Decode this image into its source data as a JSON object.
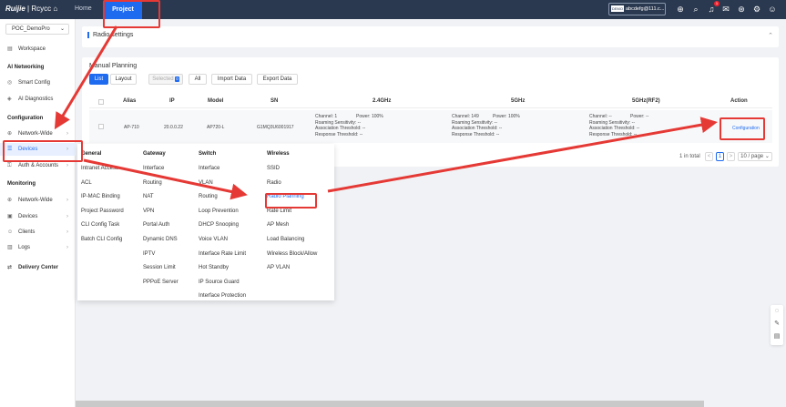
{
  "topbar": {
    "logo_brand": "Ruijie",
    "logo_sub": "| Rcycc",
    "nav_home": "Home",
    "nav_project": "Project",
    "user_tag": "DEMO",
    "user_email": "abcdefg@111.c..."
  },
  "sidebar": {
    "project_select": "POC_DemoPro",
    "workspace": "Workspace",
    "ai_networking_head": "AI Networking",
    "smart_config": "Smart Config",
    "ai_diagnostics": "AI Diagnostics",
    "configuration_head": "Configuration",
    "network_wide": "Network-Wide",
    "devices": "Devices",
    "auth_accounts": "Auth & Accounts",
    "monitoring_head": "Monitoring",
    "mon_network_wide": "Network-Wide",
    "mon_devices": "Devices",
    "mon_clients": "Clients",
    "mon_logs": "Logs",
    "delivery_center": "Delivery Center"
  },
  "radio_settings": {
    "title": "Radio settings"
  },
  "manual_planning": {
    "title": "Manual Planning",
    "btn_list": "List",
    "btn_layout": "Layout",
    "btn_selected": "Selected",
    "selected_count": "0",
    "btn_all": "All",
    "btn_import": "Import Data",
    "btn_export": "Export Data",
    "columns": [
      "Alias",
      "IP",
      "Model",
      "SN",
      "2.4GHz",
      "5GHz",
      "5GHz(RF2)",
      "Action"
    ],
    "row": {
      "alias": "AP-710",
      "ip": "20.0.0.22",
      "model": "AP720-L",
      "sn": "G1MQ3U6001917",
      "b24": {
        "channel": "Channel:  1",
        "power": "Power:  100%",
        "roaming": "Roaming Sensitivity:  --",
        "assoc": "Association Threshold:  --",
        "response": "Response Threshold:  --"
      },
      "b5": {
        "channel": "Channel:  149",
        "power": "Power:  100%",
        "roaming": "Roaming Sensitivity:  --",
        "assoc": "Association Threshold:  --",
        "response": "Response Threshold:  --"
      },
      "b5rf2": {
        "channel": "Channel:  --",
        "power": "Power:  --",
        "roaming": "Roaming Sensitivity:  --",
        "assoc": "Association Threshold:  --",
        "response": "Response Threshold:  --"
      },
      "action": "Configuration"
    },
    "pager": {
      "total": "1 in total",
      "prev": "<",
      "page": "1",
      "next": ">",
      "page_size": "10 / page"
    }
  },
  "dropdown": {
    "general": {
      "head": "General",
      "items": [
        "Intranet Access",
        "ACL",
        "IP-MAC Binding",
        "Project Password",
        "CLI Config Task",
        "Batch CLI Config"
      ]
    },
    "gateway": {
      "head": "Gateway",
      "items": [
        "Interface",
        "Routing",
        "NAT",
        "VPN",
        "Portal Auth",
        "Dynamic DNS",
        "IPTV",
        "Session Limit",
        "PPPoE Server"
      ]
    },
    "switch": {
      "head": "Switch",
      "items": [
        "Interface",
        "VLAN",
        "Routing",
        "Loop Prevention",
        "DHCP Snooping",
        "Voice VLAN",
        "Interface Rate Limit",
        "Hot Standby",
        "IP Source Guard",
        "Interface Protection"
      ]
    },
    "wireless": {
      "head": "Wireless",
      "items": [
        "SSID",
        "Radio",
        "Radio Planning",
        "Rate Limit",
        "AP Mesh",
        "Load Balancing",
        "Wireless Block/Allow",
        "AP VLAN"
      ]
    }
  },
  "colors": {
    "topbar": "#2b3950",
    "accent": "#1f6bf0",
    "annotation": "#e53935"
  }
}
